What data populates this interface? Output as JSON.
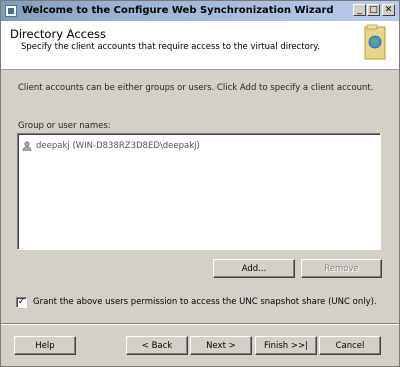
{
  "window": {
    "title": "Welcome to the Configure Web Synchronization Wizard",
    "controls": {
      "minimize": "_",
      "maximize": "□",
      "close": "✕"
    }
  },
  "header": {
    "title": "Directory Access",
    "subtitle": "Specify the client accounts that require access to the virtual directory."
  },
  "main": {
    "instructions": "Client accounts can be either groups or users. Click Add to specify a client account.",
    "list_label": "Group or user names:",
    "list_items": [
      {
        "name": "deepakj (WIN-D838RZ3D8ED\\deepakj)",
        "icon": "user-icon"
      }
    ],
    "add_label": "Add...",
    "remove_label": "Remove",
    "checkbox_label": "Grant the above users permission to access the UNC snapshot share (UNC only).",
    "checkbox_checked": true,
    "checkbox_mark": "✓"
  },
  "footer": {
    "help_label": "Help",
    "back_label": "< Back",
    "next_label": "Next >",
    "finish_label": "Finish >>|",
    "cancel_label": "Cancel"
  }
}
